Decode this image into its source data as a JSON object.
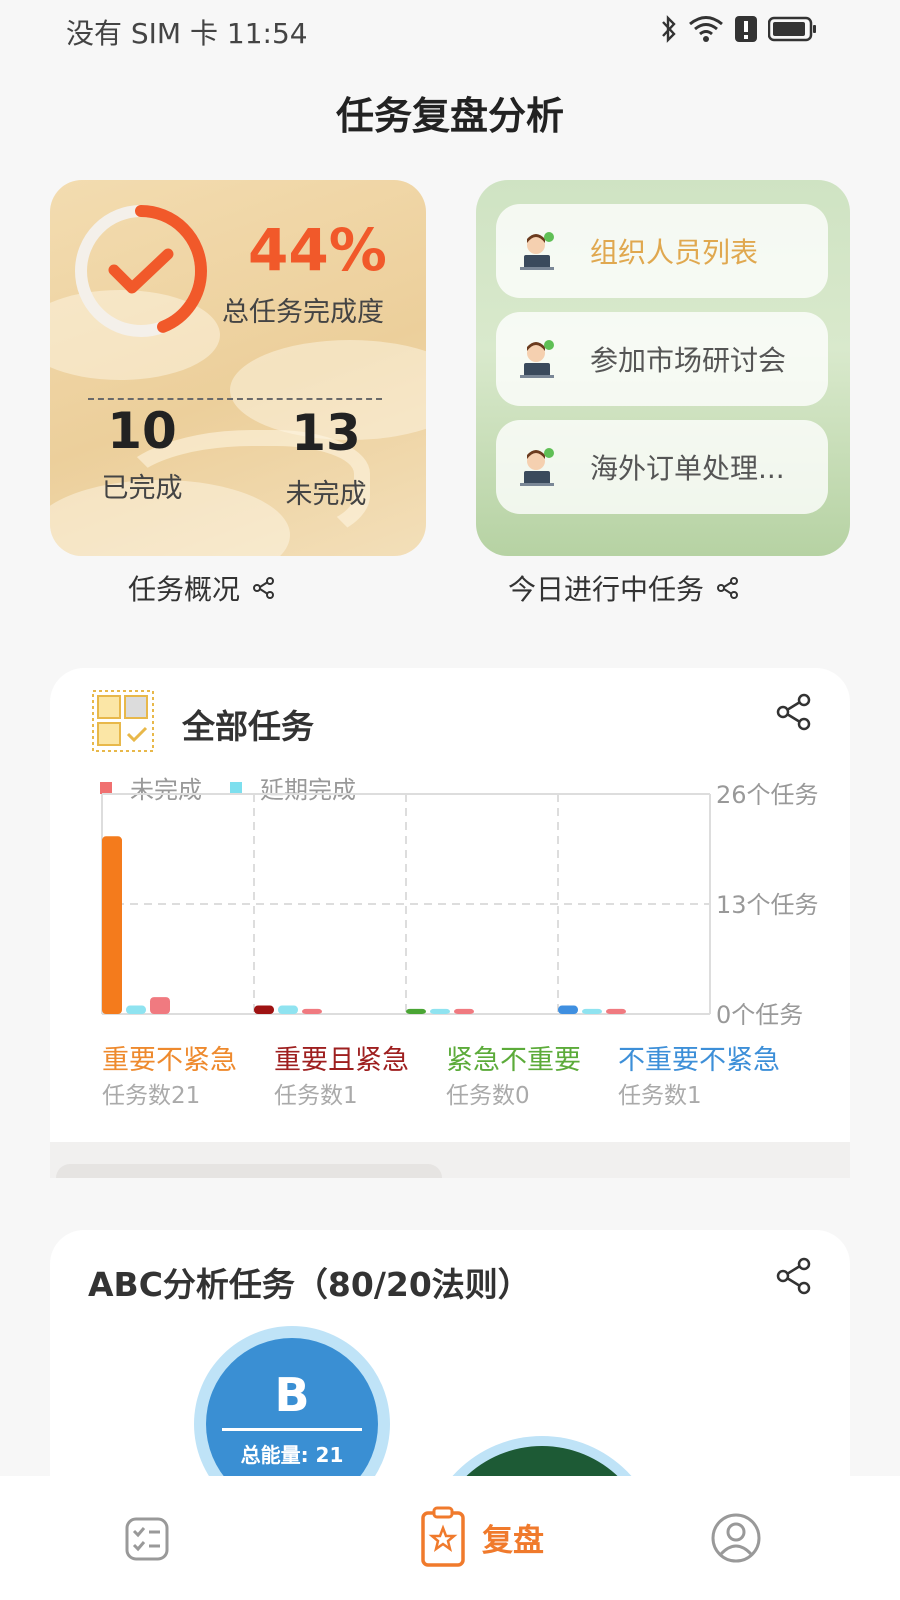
{
  "status_bar": {
    "left_text": "没有 SIM 卡 11:54"
  },
  "page_title": "任务复盘分析",
  "overview_card": {
    "percent": "44%",
    "percent_value": 44,
    "percent_label": "总任务完成度",
    "completed_count": "10",
    "completed_label": "已完成",
    "incomplete_count": "13",
    "incomplete_label": "未完成",
    "caption": "任务概况"
  },
  "today_card": {
    "tasks": [
      "组织人员列表",
      "参加市场研讨会",
      "海外订单处理..."
    ],
    "caption": "今日进行中任务"
  },
  "all_tasks": {
    "title": "全部任务",
    "legend": [
      {
        "label": "未完成",
        "color": "#f07070"
      },
      {
        "label": "延期完成",
        "color": "#7ddfee"
      }
    ],
    "quadrants": [
      {
        "name": "重要不紧急",
        "count_label": "任务数21",
        "color": "#ee8a2e"
      },
      {
        "name": "重要且紧急",
        "count_label": "任务数1",
        "color": "#9e1f1f"
      },
      {
        "name": "紧急不重要",
        "count_label": "任务数0",
        "color": "#5cab3a"
      },
      {
        "name": "不重要不紧急",
        "count_label": "任务数1",
        "color": "#3d8fd8"
      }
    ]
  },
  "chart_data": {
    "type": "bar",
    "categories": [
      "重要不紧急",
      "重要且紧急",
      "紧急不重要",
      "不重要不紧急"
    ],
    "series": [
      {
        "values": [
          21,
          1,
          0.6,
          1
        ],
        "colors": [
          "#f47b1c",
          "#9e1212",
          "#4aa534",
          "#3f8fe0"
        ]
      },
      {
        "name": "延期完成",
        "values": [
          1,
          1,
          0.6,
          0.6
        ],
        "color": "#8fe3f0"
      },
      {
        "name": "未完成",
        "values": [
          2,
          0.6,
          0.6,
          0.6
        ],
        "color": "#f07a80"
      }
    ],
    "y_ticks": [
      "26个任务",
      "13个任务",
      "0个任务"
    ],
    "ylim": [
      0,
      26
    ],
    "grid": true
  },
  "abc_card": {
    "title": "ABC分析任务（80/20法则）",
    "bubble_b_letter": "B",
    "bubble_b_energy": "总能量: 21"
  },
  "bottom_nav": {
    "active_label": "复盘"
  }
}
